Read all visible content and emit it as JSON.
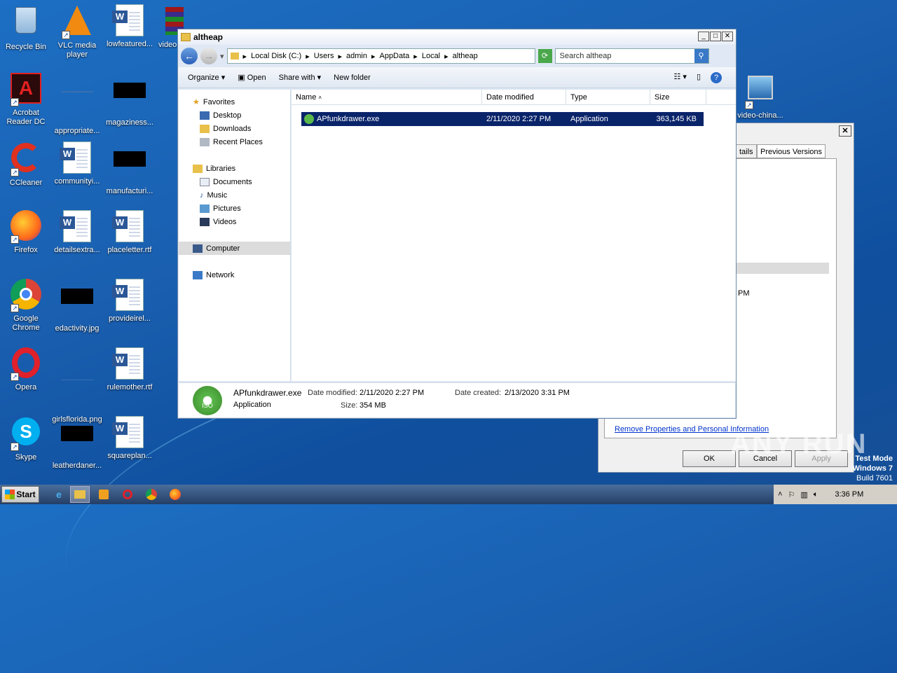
{
  "desktop": {
    "icons": [
      {
        "label": "Recycle Bin"
      },
      {
        "label": "VLC media player"
      },
      {
        "label": "lowfeatured..."
      },
      {
        "label": "video"
      },
      {
        "label": "Acrobat Reader DC"
      },
      {
        "label": "appropriate..."
      },
      {
        "label": "magaziness..."
      },
      {
        "label": "CCleaner"
      },
      {
        "label": "communityi..."
      },
      {
        "label": "manufacturi..."
      },
      {
        "label": "Firefox"
      },
      {
        "label": "detailsextra..."
      },
      {
        "label": "placeletter.rtf"
      },
      {
        "label": "Google Chrome"
      },
      {
        "label": "edactivity.jpg"
      },
      {
        "label": "provideirel..."
      },
      {
        "label": "Opera"
      },
      {
        "label": "girlsflorida.png"
      },
      {
        "label": "rulemother.rtf"
      },
      {
        "label": "Skype"
      },
      {
        "label": "leatherdaner..."
      },
      {
        "label": "squareplan..."
      },
      {
        "label": "video-china..."
      }
    ]
  },
  "explorer": {
    "title": "altheap",
    "breadcrumbs": [
      "Local Disk (C:)",
      "Users",
      "admin",
      "AppData",
      "Local",
      "altheap"
    ],
    "search_placeholder": "Search altheap",
    "toolbar": {
      "organize": "Organize",
      "open": "Open",
      "share_with": "Share with",
      "new_folder": "New folder"
    },
    "nav": {
      "favorites": "Favorites",
      "desktop": "Desktop",
      "downloads": "Downloads",
      "recent_places": "Recent Places",
      "libraries": "Libraries",
      "documents": "Documents",
      "music": "Music",
      "pictures": "Pictures",
      "videos": "Videos",
      "computer": "Computer",
      "network": "Network"
    },
    "columns": {
      "name": "Name",
      "date_modified": "Date modified",
      "type": "Type",
      "size": "Size"
    },
    "files": [
      {
        "name": "APfunkdrawer.exe",
        "date_modified": "2/11/2020 2:27 PM",
        "type": "Application",
        "size": "363,145 KB"
      }
    ],
    "details": {
      "name": "APfunkdrawer.exe",
      "type": "Application",
      "date_modified_label": "Date modified:",
      "date_modified": "2/11/2020 2:27 PM",
      "size_label": "Size:",
      "size": "354 MB",
      "date_created_label": "Date created:",
      "date_created": "2/13/2020 3:31 PM"
    }
  },
  "properties": {
    "tab_details": "tails",
    "tab_previous": "Previous Versions",
    "partial_text": "PM",
    "remove_link": "Remove Properties and Personal Information",
    "ok": "OK",
    "cancel": "Cancel",
    "apply": "Apply"
  },
  "taskbar": {
    "start": "Start",
    "clock": "3:36 PM"
  },
  "overlay": {
    "watermark": "ANY RUN",
    "test_mode_1": "Test Mode",
    "test_mode_2": "Windows 7",
    "test_mode_3": "Build 7601"
  }
}
